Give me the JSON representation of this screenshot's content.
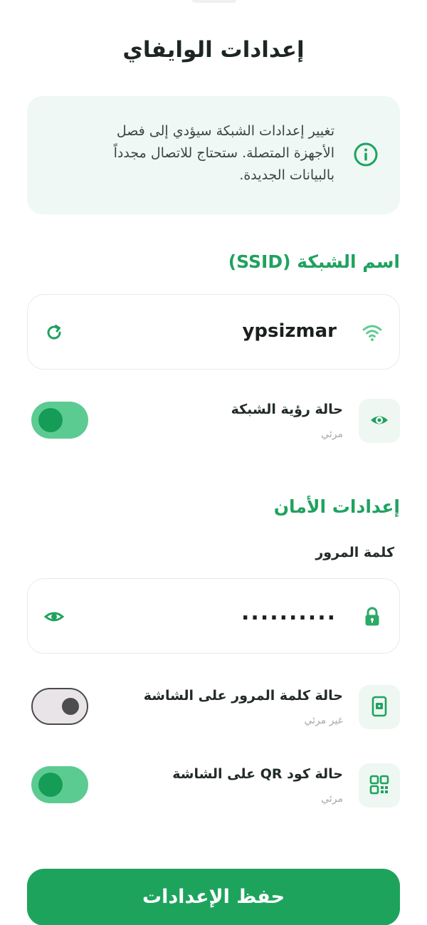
{
  "header": {
    "title": "إعدادات الوايفاي"
  },
  "notice": {
    "icon": "info-icon",
    "lines": [
      "تغيير إعدادات الشبكة سيؤدي إلى فصل",
      "الأجهزة المتصلة. ستحتاج للاتصال مجدداً",
      "بالبيانات الجديدة."
    ]
  },
  "ssid_section": {
    "title": "اسم الشبكة (SSID)",
    "field": {
      "value": "ypsizmar",
      "leading_icon": "wifi-icon",
      "trailing_icon": "refresh-icon"
    },
    "visibility": {
      "label": "حالة رؤية الشبكة",
      "status": "مرئي",
      "icon": "eye-icon",
      "enabled": true
    }
  },
  "security_section": {
    "title": "إعدادات الأمان",
    "password_label": "كلمة المرور",
    "password_field": {
      "value": "..........",
      "leading_icon": "lock-icon",
      "trailing_icon": "eye-icon"
    },
    "password_on_screen": {
      "label": "حالة كلمة المرور على الشاشة",
      "status": "غير مرئي",
      "icon": "phone-screen-icon",
      "enabled": false
    },
    "qr_on_screen": {
      "label": "حالة كود QR على الشاشة",
      "status": "مرئي",
      "icon": "qr-code-icon",
      "enabled": true
    }
  },
  "actions": {
    "save_label": "حفظ الإعدادات"
  },
  "colors": {
    "accent": "#1ea35d",
    "accent_light": "#eff8f4",
    "toggle_on": "#5ccb91"
  }
}
